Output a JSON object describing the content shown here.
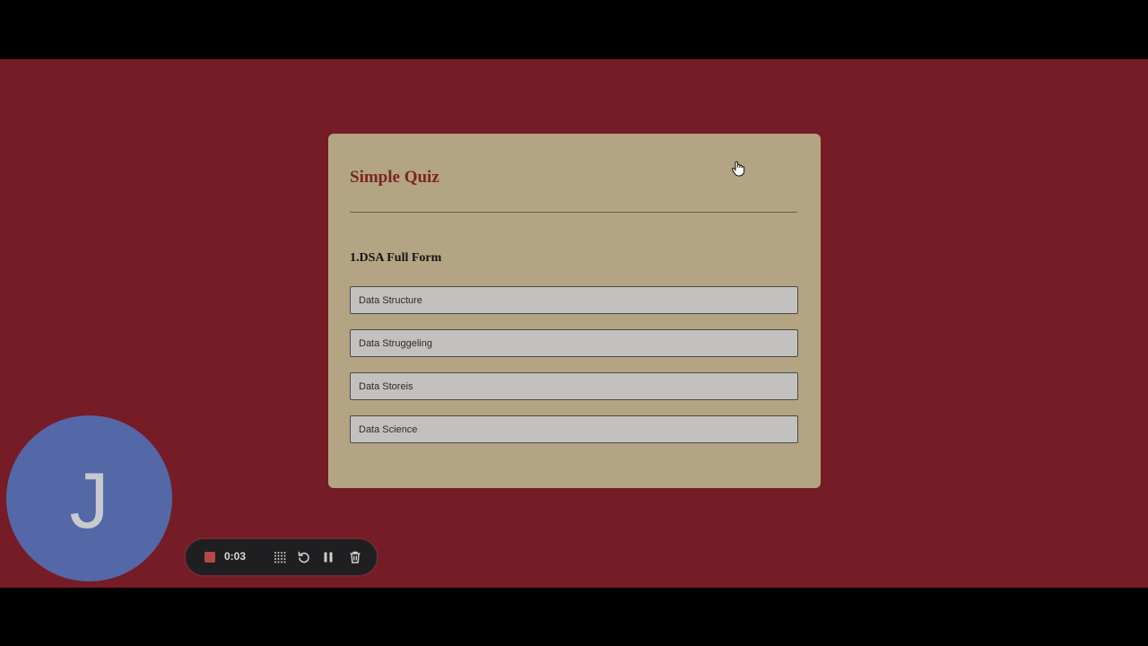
{
  "quiz": {
    "title": "Simple Quiz",
    "question": "1.DSA Full Form",
    "options": [
      "Data Structure",
      "Data Struggeling",
      "Data Storeis",
      "Data Science"
    ]
  },
  "avatar": {
    "initial": "J"
  },
  "recorder": {
    "timer": "0:03"
  },
  "colors": {
    "background": "#761c26",
    "card": "#b3a483",
    "title": "#7a2424",
    "option": "#c3c1bf",
    "avatar": "#5468a8",
    "record": "#b8474a"
  },
  "icons": {
    "cursor": "hand-pointer-icon",
    "stop": "stop-record-icon",
    "grid": "drag-handle-icon",
    "restart": "restart-icon",
    "pause": "pause-icon",
    "delete": "trash-icon"
  }
}
